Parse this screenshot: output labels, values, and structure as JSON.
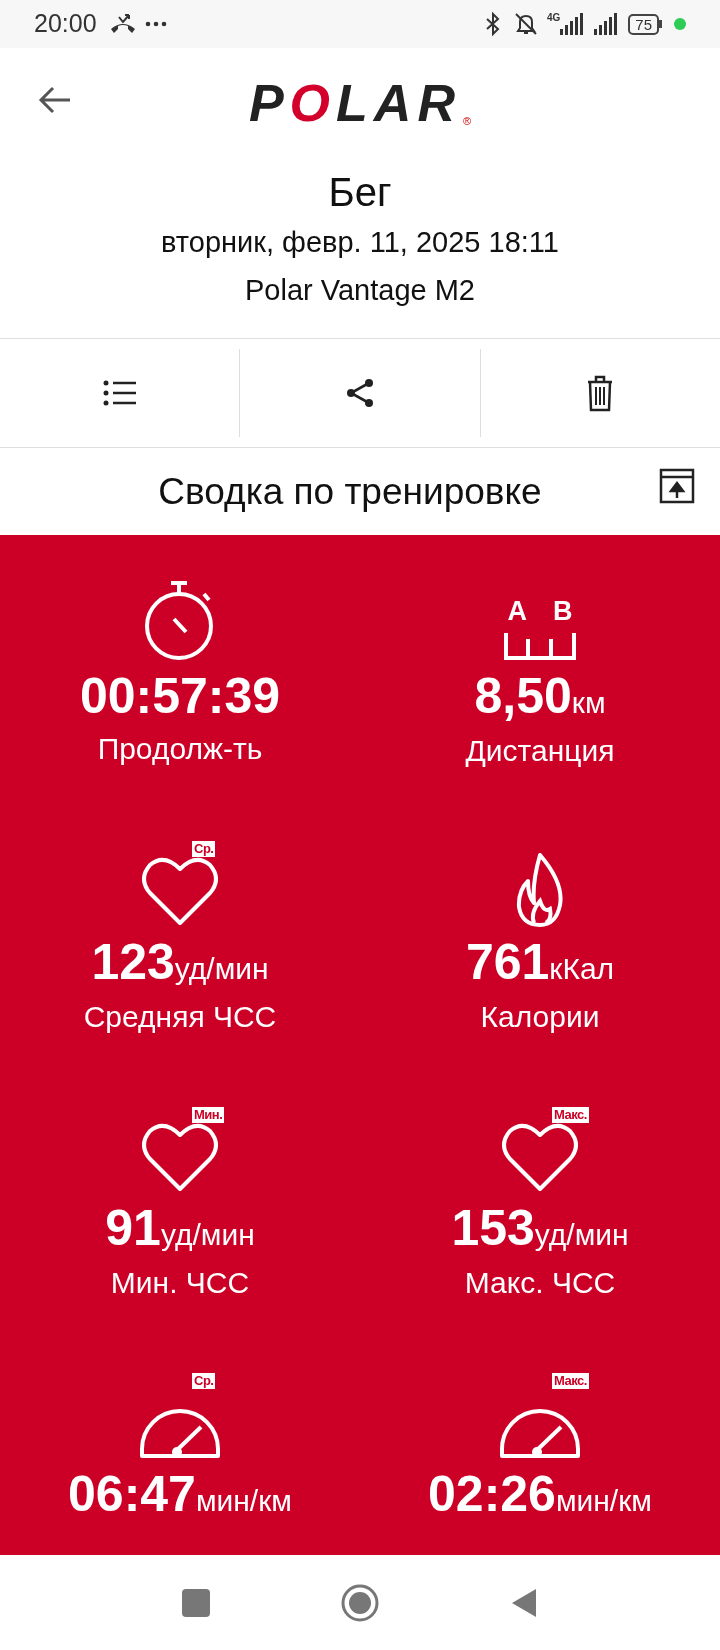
{
  "status_bar": {
    "time": "20:00",
    "network": "4G",
    "battery": "75"
  },
  "header": {
    "logo": "POLAR",
    "logo_mark": "®"
  },
  "activity": {
    "title": "Бег",
    "date": "вторник, февр. 11, 2025 18:11",
    "device": "Polar Vantage M2"
  },
  "actions": [
    {
      "kind": "list"
    },
    {
      "kind": "share"
    },
    {
      "kind": "delete"
    }
  ],
  "summary": {
    "title": "Сводка по тренировке"
  },
  "distance_icon_letters": [
    "A",
    "B"
  ],
  "stats": [
    {
      "kind": "stopwatch",
      "value": "00:57:39",
      "label": "Продолж-ть"
    },
    {
      "kind": "distance",
      "value": "8,50",
      "unit": "км",
      "label": "Дистанция"
    },
    {
      "kind": "heart",
      "badge": "Ср.",
      "value": "123",
      "unit": "уд/мин",
      "label": "Средняя ЧСС"
    },
    {
      "kind": "flame",
      "value": "761",
      "unit": "кКал",
      "label": "Калории"
    },
    {
      "kind": "heart",
      "badge": "Мин.",
      "value": "91",
      "unit": "уд/мин",
      "label": "Мин. ЧСС"
    },
    {
      "kind": "heart",
      "badge": "Макс.",
      "value": "153",
      "unit": "уд/мин",
      "label": "Макс. ЧСС"
    },
    {
      "kind": "gauge",
      "badge": "Ср.",
      "value": "06:47",
      "unit": "мин/км"
    },
    {
      "kind": "gauge",
      "badge": "Макс.",
      "value": "02:26",
      "unit": "мин/км"
    }
  ]
}
